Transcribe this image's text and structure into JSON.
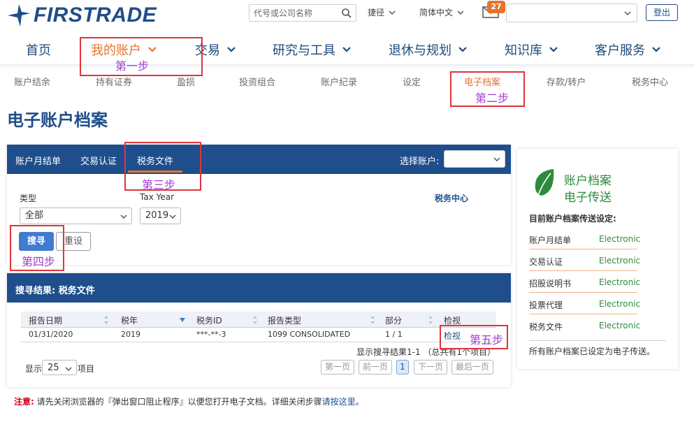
{
  "header": {
    "logo": "FIRSTRADE",
    "search_placeholder": "代号或公司名称",
    "shortcut_label": "捷径",
    "language_label": "简体中文",
    "mail_count": "27",
    "logout_label": "登出"
  },
  "main_nav": [
    {
      "label": "首页"
    },
    {
      "label": "我的账户"
    },
    {
      "label": "交易"
    },
    {
      "label": "研究与工具"
    },
    {
      "label": "退休与规划"
    },
    {
      "label": "知识库"
    },
    {
      "label": "客户服务"
    }
  ],
  "sub_nav": [
    {
      "label": "账户结余"
    },
    {
      "label": "持有证券"
    },
    {
      "label": "盈损"
    },
    {
      "label": "投资组合"
    },
    {
      "label": "账户纪录"
    },
    {
      "label": "设定"
    },
    {
      "label": "电子档案"
    },
    {
      "label": "存款/转户"
    },
    {
      "label": "税务中心"
    }
  ],
  "page_title": "电子账户档案",
  "panel": {
    "tabs": [
      {
        "label": "账户月结单"
      },
      {
        "label": "交易认证"
      },
      {
        "label": "税务文件"
      }
    ],
    "account_label": "选择账户:",
    "type_label": "类型",
    "type_value": "全部",
    "year_label": "Tax Year",
    "year_value": "2019",
    "tax_center_link": "税务中心",
    "search_button": "搜寻",
    "reset_button": "重设"
  },
  "results": {
    "title": "搜寻结果: 税务文件",
    "columns": [
      "报告日期",
      "税年",
      "税务ID",
      "报告类型",
      "部分",
      "检视"
    ],
    "rows": [
      {
        "date": "01/31/2020",
        "year": "2019",
        "tax_id": "***-**-3",
        "type": "1099 CONSOLIDATED",
        "part": "1 / 1",
        "view": "检视"
      }
    ],
    "count_text": "显示搜寻结果1-1 （总共有1个项目）",
    "show_label": "显示",
    "page_size": "25",
    "items_label": "项目",
    "pagination": {
      "first": "第一页",
      "prev": "前一页",
      "current": "1",
      "next": "下一页",
      "last": "最后一页"
    }
  },
  "card": {
    "title_line1": "账户档案",
    "title_line2": "电子传送",
    "subtitle": "目前账户档案传送设定:",
    "rows": [
      {
        "label": "账户月结单",
        "value": "Electronic"
      },
      {
        "label": "交易认证",
        "value": "Electronic"
      },
      {
        "label": "招股说明书",
        "value": "Electronic"
      },
      {
        "label": "投票代理",
        "value": "Electronic"
      },
      {
        "label": "税务文件",
        "value": "Electronic"
      }
    ],
    "footer": "所有账户档案已设定为电子传送。"
  },
  "notice": {
    "warn": "注意:",
    "text": "请先关闭浏览器的『弹出窗口阻止程序』以便您打开电子文档。详细关闭步骤",
    "link": "请按这里",
    "end": "。"
  },
  "steps": [
    "第一步",
    "第二步",
    "第三步",
    "第四步",
    "第五步"
  ],
  "colors": {
    "brand_blue": "#1f4e8c",
    "accent_orange": "#e8732c",
    "green": "#2e8b3c",
    "annotation_red": "#e0353b",
    "annotation_purple": "#a13cd0"
  }
}
